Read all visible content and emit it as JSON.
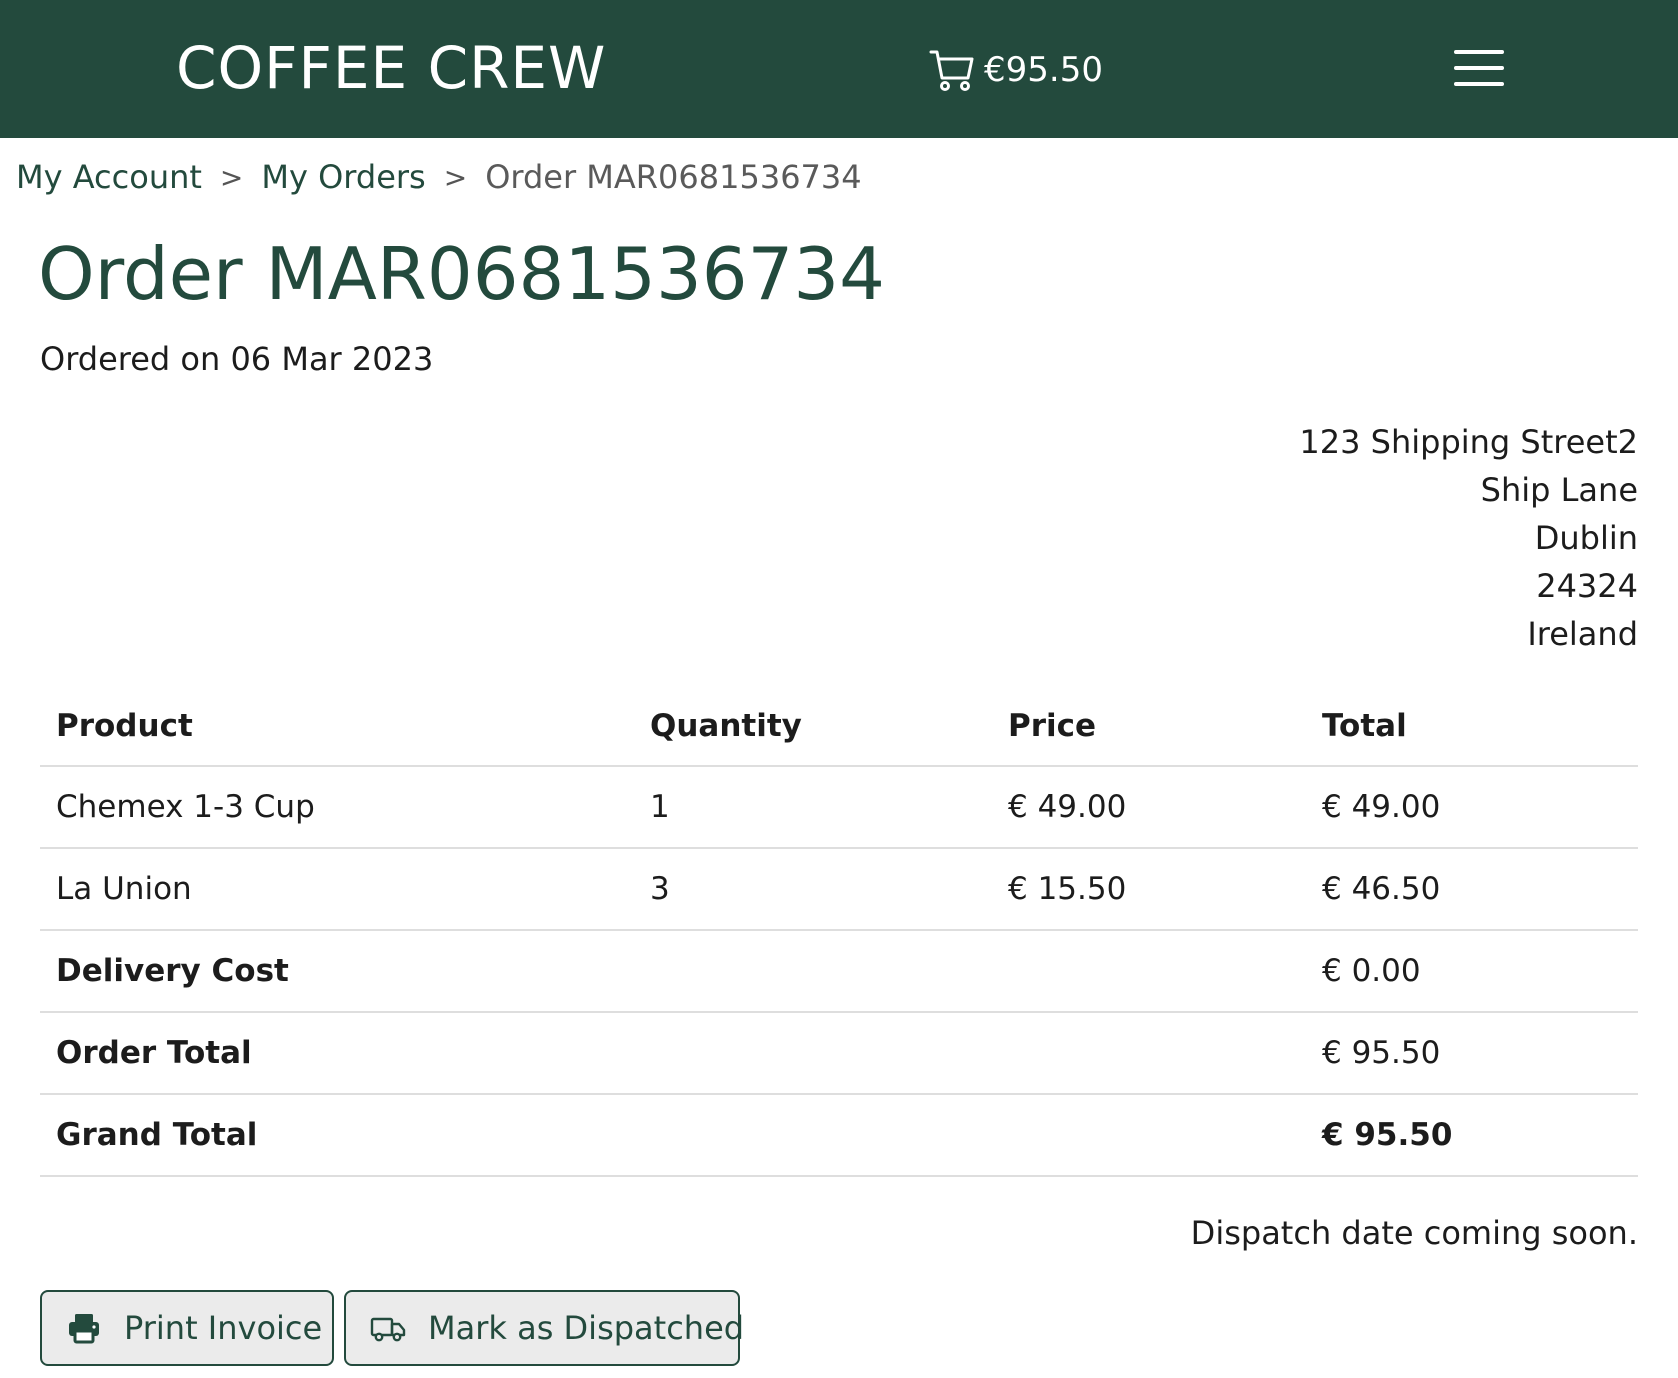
{
  "header": {
    "brand": "COFFEE CREW",
    "cart_amount": "€95.50",
    "cart_icon": "cart-icon",
    "menu_icon": "hamburger-menu-icon",
    "background_color": "#234a3d"
  },
  "breadcrumb": {
    "items": [
      {
        "label": "My Account"
      },
      {
        "label": "My Orders"
      },
      {
        "label": "Order MAR0681536734"
      }
    ],
    "separator": ">"
  },
  "order": {
    "title": "Order MAR0681536734",
    "ordered_on": "Ordered on 06 Mar 2023",
    "address": [
      "123 Shipping Street2",
      "Ship Lane",
      "Dublin",
      "24324",
      "Ireland"
    ]
  },
  "table": {
    "headers": [
      "Product",
      "Quantity",
      "Price",
      "Total"
    ],
    "rows": [
      {
        "product": "Chemex 1-3 Cup",
        "quantity": "1",
        "price": "€ 49.00",
        "total": "€ 49.00"
      },
      {
        "product": "La Union",
        "quantity": "3",
        "price": "€ 15.50",
        "total": "€ 46.50"
      }
    ],
    "delivery": {
      "label": "Delivery Cost",
      "value": "€ 0.00"
    },
    "order_total": {
      "label": "Order Total",
      "value": "€ 95.50"
    },
    "grand_total": {
      "label": "Grand Total",
      "value": "€ 95.50"
    }
  },
  "dispatch_note": "Dispatch date coming soon.",
  "actions": {
    "print_label": "Print Invoice",
    "print_icon": "printer-icon",
    "dispatch_label": "Mark as Dispatched",
    "dispatch_icon": "truck-icon"
  },
  "colors": {
    "brand": "#234a3d",
    "button_bg": "#ebebeb",
    "row_border": "#dedede"
  }
}
